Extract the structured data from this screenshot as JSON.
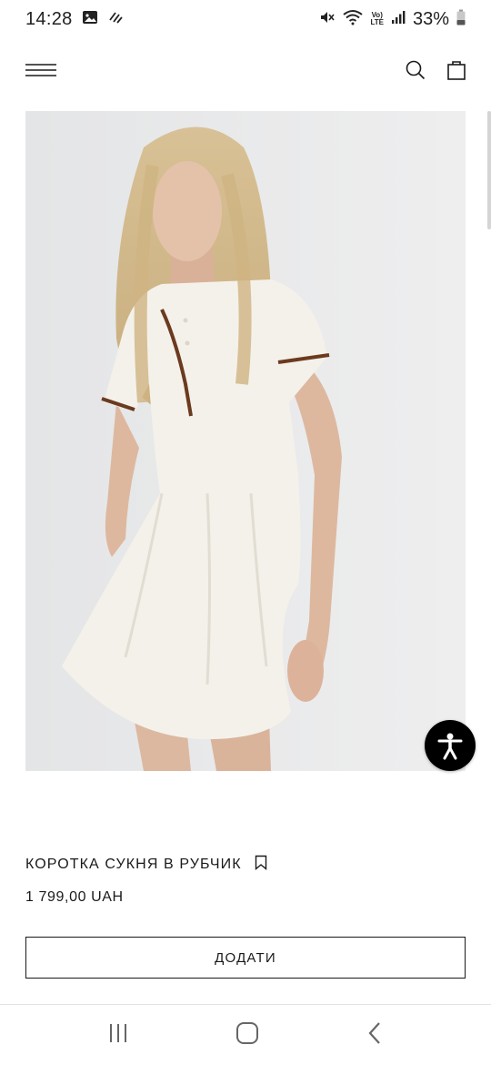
{
  "status_bar": {
    "time": "14:28",
    "battery_percent": "33%",
    "network_label_top": "Vo)",
    "network_label_bottom": "LTE",
    "icons": [
      "gallery-icon",
      "data-sync-icon",
      "mute-icon",
      "wifi-icon",
      "signal-icon",
      "battery-icon"
    ]
  },
  "header": {
    "icons": [
      "hamburger-menu-icon",
      "search-icon",
      "shopping-bag-icon"
    ]
  },
  "product": {
    "image_description_icon": "product-photo",
    "title": "КОРОТКА СУКНЯ В РУБЧИК",
    "price": "1 799,00 UAH",
    "add_button_label": "ДОДАТИ"
  },
  "accessibility": {
    "icon": "accessibility-icon"
  },
  "system_nav": {
    "icons": [
      "recent-apps-icon",
      "home-icon",
      "back-icon"
    ]
  },
  "colors": {
    "text": "#1a1a1a",
    "background": "#ffffff",
    "fab": "#000000",
    "dress_trim": "#6b3a1f"
  }
}
